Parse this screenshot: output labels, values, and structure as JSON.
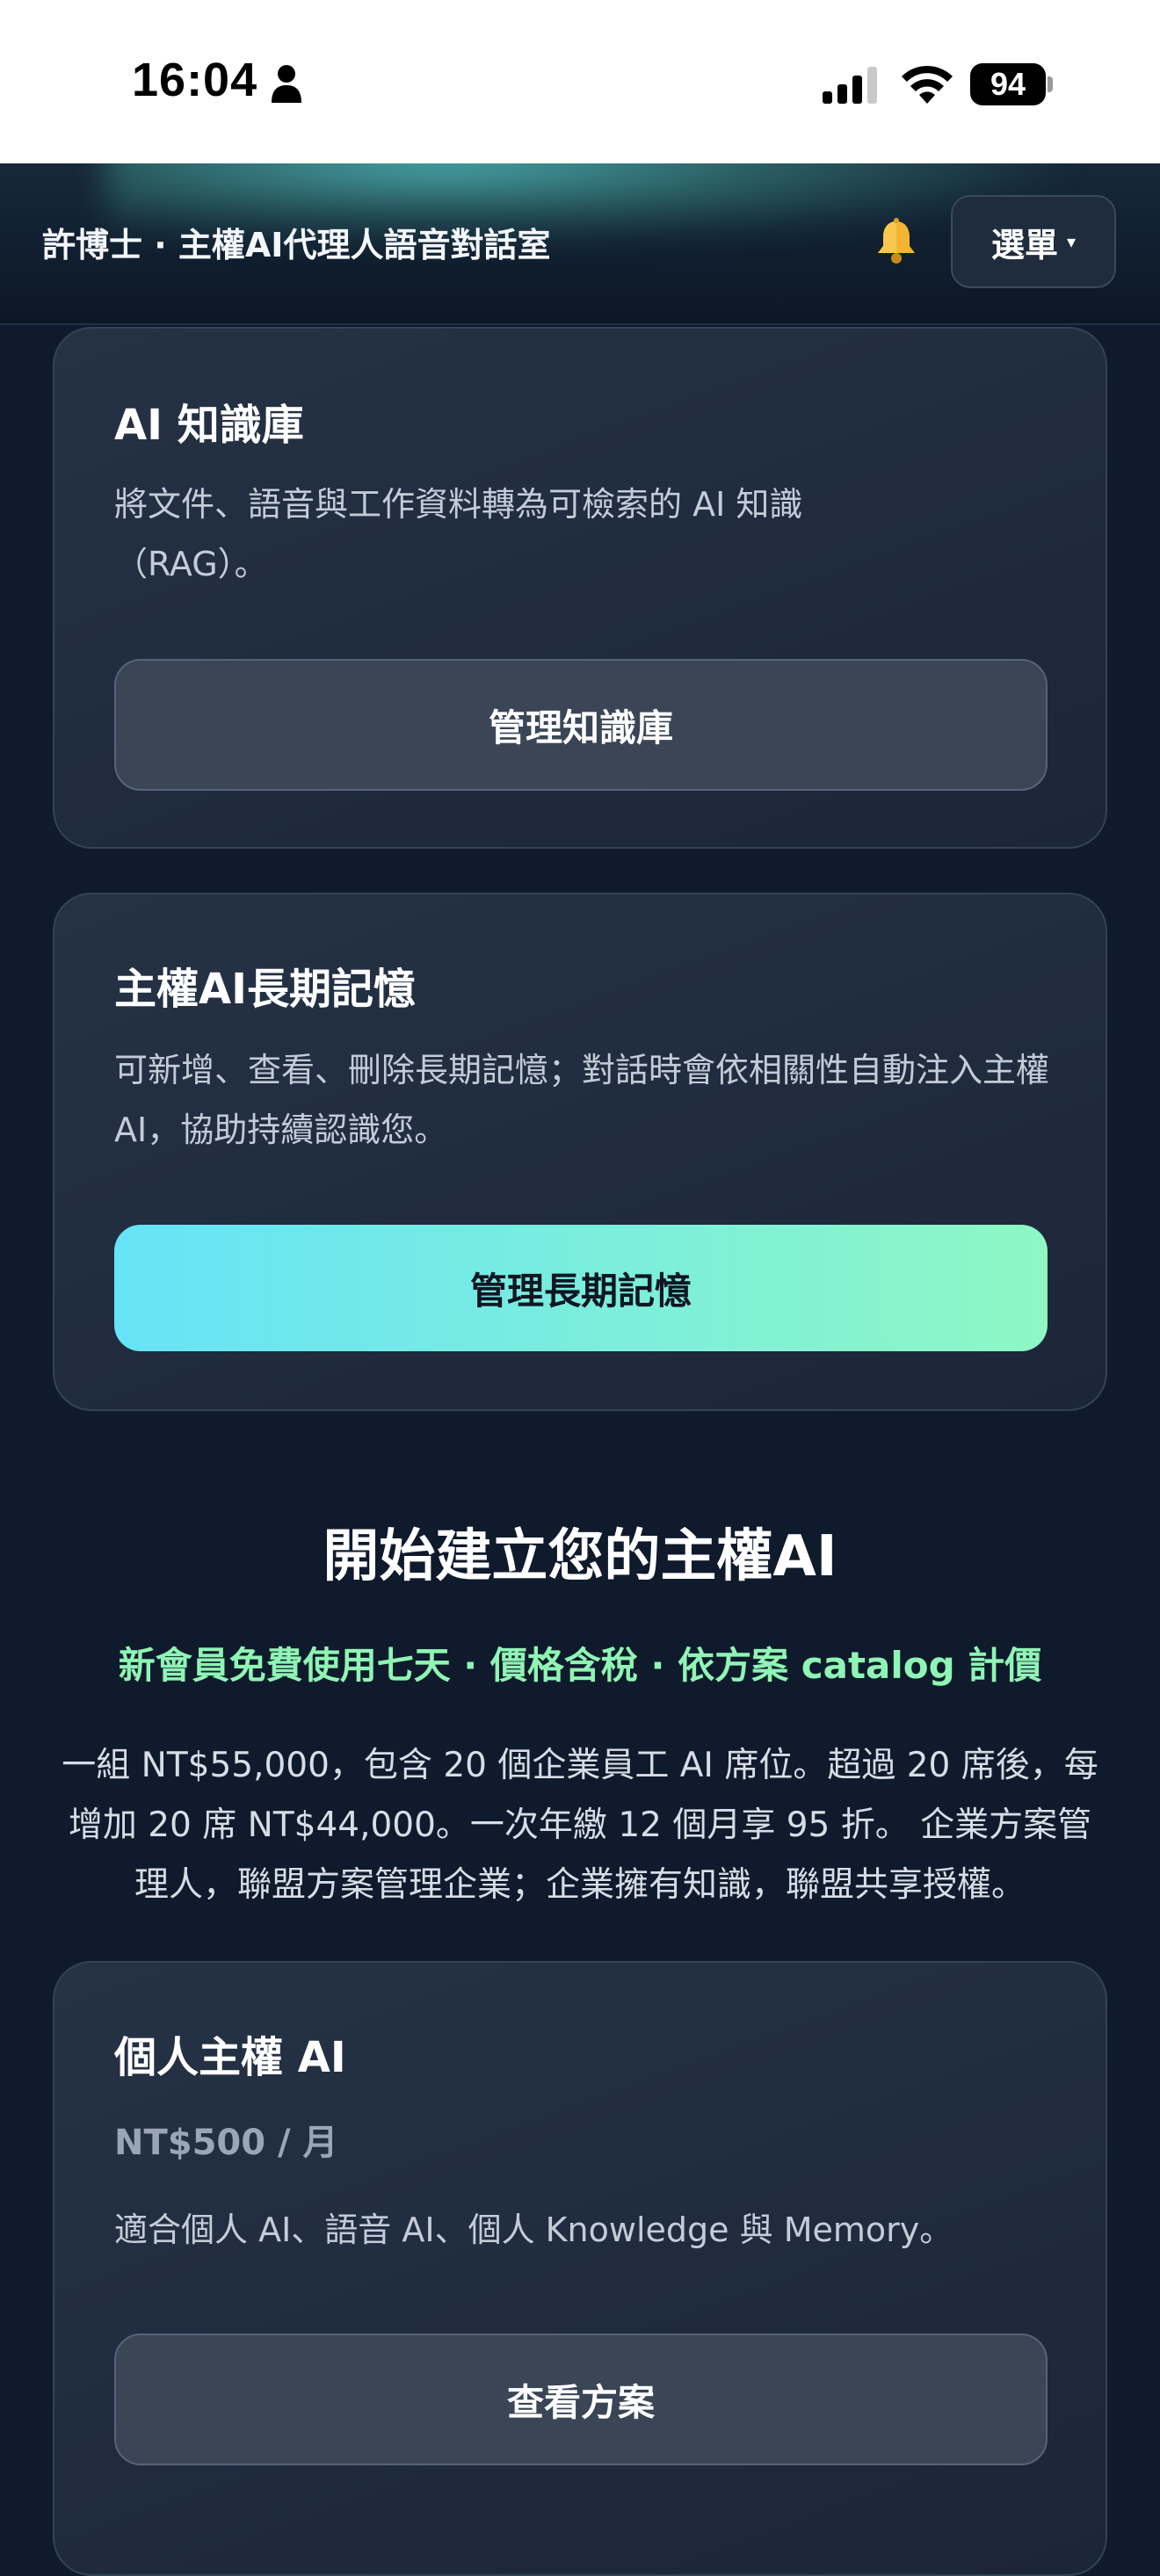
{
  "status_bar": {
    "time": "16:04",
    "battery": "94"
  },
  "header": {
    "title": "許博士 · 主權AI代理人語音對話室",
    "menu_label": "選單",
    "menu_caret": "▾",
    "bell_icon": "bell-icon"
  },
  "knowledge_card": {
    "title": "AI 知識庫",
    "description": "將文件、語音與工作資料轉為可檢索的 AI 知識（RAG）。",
    "button_label": "管理知識庫"
  },
  "memory_card": {
    "title": "主權AI長期記憶",
    "description": "可新增、查看、刪除長期記憶；對話時會依相關性自動注入主權AI，協助持續認識您。",
    "button_label": "管理長期記憶"
  },
  "pricing": {
    "title": "開始建立您的主權AI",
    "promo": "新會員免費使用七天 · 價格含稅 · 依方案 catalog 計價",
    "description": "一組 NT$55,000，包含 20 個企業員工 AI 席位。超過 20 席後，每增加 20 席 NT$44,000。一次年繳 12 個月享 95 折。 企業方案管理人，聯盟方案管理企業；企業擁有知識，聯盟共享授權。"
  },
  "personal_plan": {
    "title": "個人主權 AI",
    "price": "NT$500 / 月",
    "description": "適合個人 AI、語音 AI、個人 Knowledge 與 Memory。",
    "button_label": "查看方案"
  },
  "colors": {
    "background": "#0f1a2c",
    "card": "#222e41",
    "accent_gradient_start": "#66e3f7",
    "accent_gradient_end": "#8ef7c4",
    "promo_green": "#8ff5b4"
  }
}
